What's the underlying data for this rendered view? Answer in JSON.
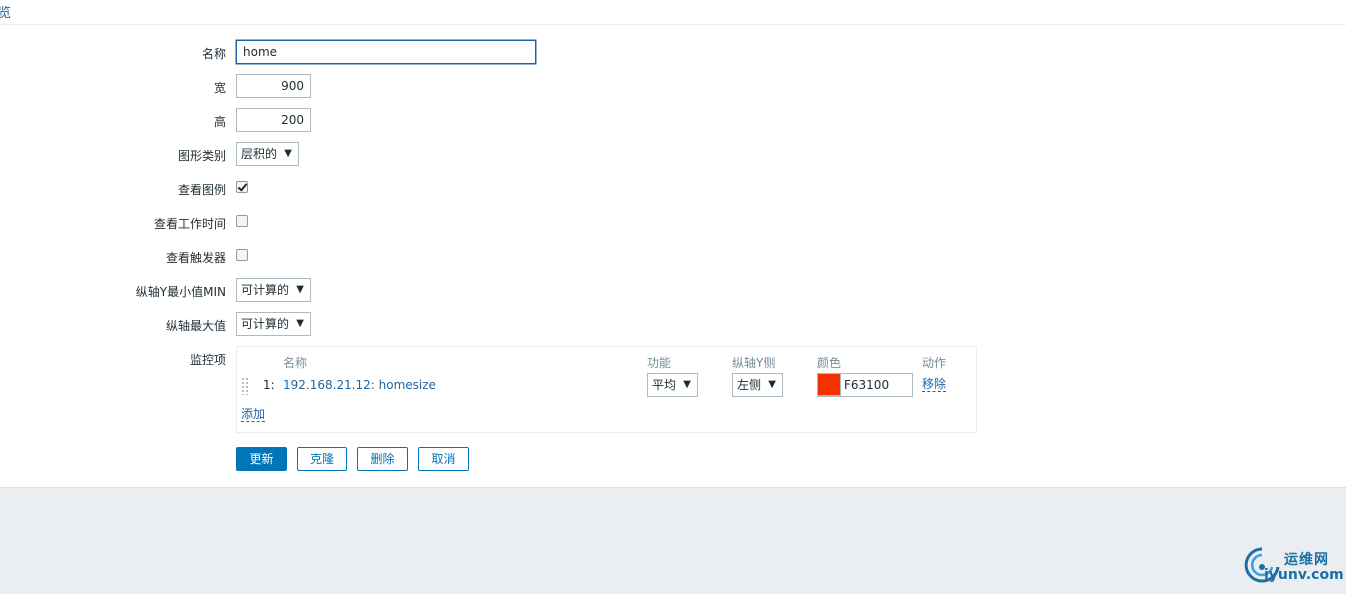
{
  "top": {
    "tab_label": "览"
  },
  "form": {
    "name_label": "名称",
    "name_value": "home",
    "width_label": "宽",
    "width_value": "900",
    "height_label": "高",
    "height_value": "200",
    "graph_type_label": "图形类别",
    "graph_type_value": "层积的",
    "show_legend_label": "查看图例",
    "show_legend_checked": true,
    "show_working_time_label": "查看工作时间",
    "show_working_time_checked": false,
    "show_triggers_label": "查看触发器",
    "show_triggers_checked": false,
    "ymin_label": "纵轴Y最小值MIN",
    "ymin_value": "可计算的",
    "ymax_label": "纵轴最大值",
    "ymax_value": "可计算的",
    "items_label": "监控项"
  },
  "items_table": {
    "headers": {
      "name": "名称",
      "function": "功能",
      "y_side": "纵轴Y侧",
      "color": "颜色",
      "action": "动作"
    },
    "rows": [
      {
        "index": "1:",
        "name": "192.168.21.12: homesize",
        "function": "平均",
        "y_side": "左侧",
        "color_hex": "#F63100",
        "color_value": "F63100",
        "action": "移除"
      }
    ],
    "add_label": "添加"
  },
  "buttons": {
    "update": "更新",
    "clone": "克隆",
    "delete": "删除",
    "cancel": "取消"
  },
  "watermark": {
    "cn": "运维网",
    "en": "iyunv.com"
  },
  "colors": {
    "accent": "#0275b8",
    "link": "#1f65a6",
    "footer_bg": "#ebeef0"
  }
}
